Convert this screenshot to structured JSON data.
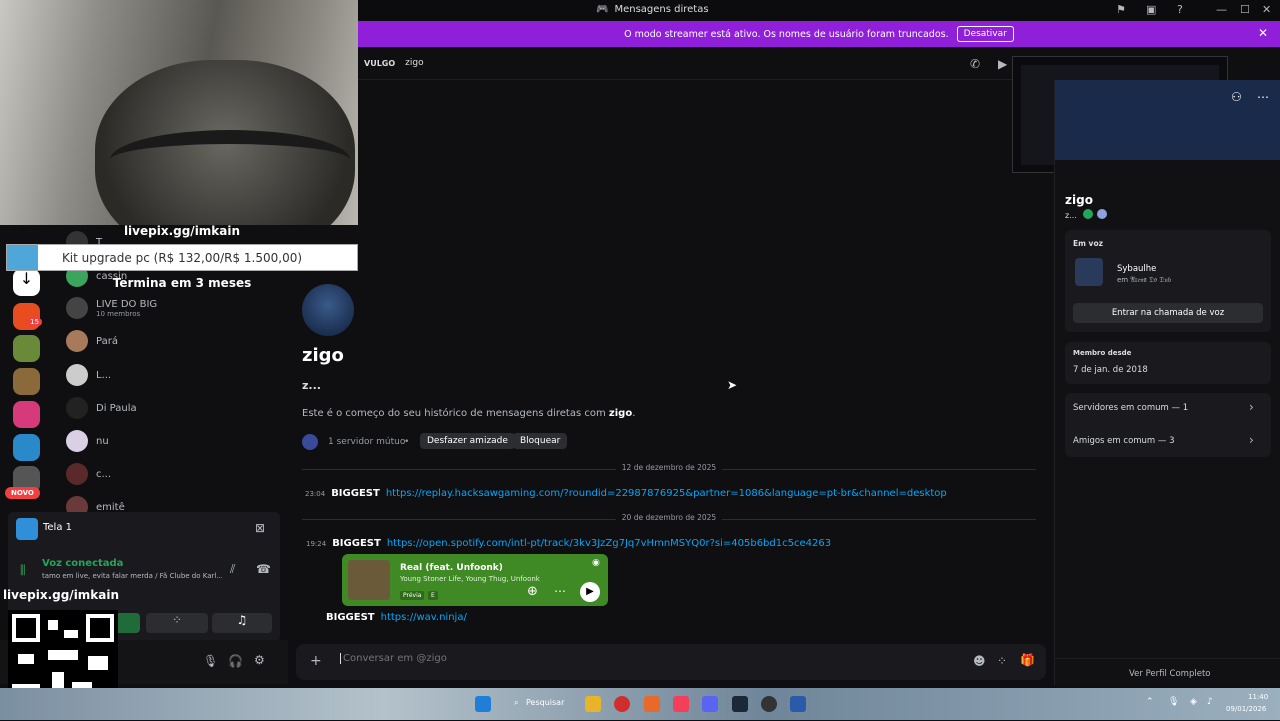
{
  "window": {
    "title": "Mensagens diretas"
  },
  "streamer_banner": {
    "text": "O modo streamer está ativo. Os nomes de usuário foram truncados.",
    "button": "Desativar"
  },
  "topbar": {
    "tag": "VULGO",
    "name": "zigo"
  },
  "overlay": {
    "livepix_top": "livepix.gg/imkain",
    "goal_label": "Kit upgrade pc (R$ 132,00/R$ 1.500,00)",
    "goal_progress": 0.088,
    "ends": "Termina em 3 meses",
    "livepix_bottom": "livepix.gg/imkain"
  },
  "servers": {
    "badge_15": "15",
    "new_badge": "NOVO"
  },
  "dm_list": [
    {
      "name": "T",
      "sub": ""
    },
    {
      "name": "cassin",
      "sub": ""
    },
    {
      "name": "LIVE DO BIG",
      "sub": "10 membros"
    },
    {
      "name": "Pará",
      "sub": ""
    },
    {
      "name": "L...",
      "sub": ""
    },
    {
      "name": "Di Paula",
      "sub": ""
    },
    {
      "name": "nu",
      "sub": ""
    },
    {
      "name": "c...",
      "sub": ""
    },
    {
      "name": "emitê",
      "sub": ""
    }
  ],
  "screen_share": {
    "title": "Tela 1"
  },
  "voice": {
    "status": "Voz conectada",
    "channel": "tamo em live, evita falar merda / Fã Clube do Karl..."
  },
  "profile_intro": {
    "name": "zigo",
    "status": "z...",
    "intro_prefix": "Este é o começo do seu histórico de mensagens diretas com ",
    "intro_name": "zigo",
    "mutual_servers": "1 servidor mútuo",
    "unfriend": "Desfazer amizade",
    "block": "Bloquear"
  },
  "messages": [
    {
      "date": "12 de dezembro de 2025"
    },
    {
      "time": "23:04",
      "author": "BIGGEST",
      "link": "https://replay.hacksawgaming.com/?roundid=22987876925&partner=1086&language=pt-br&channel=desktop"
    },
    {
      "date": "20 de dezembro de 2025"
    },
    {
      "time": "19:24",
      "author": "BIGGEST",
      "link": "https://open.spotify.com/intl-pt/track/3kv3JzZg7Jq7vHmnMSYQ0r?si=405b6bd1c5ce4263"
    },
    {
      "author": "BIGGEST",
      "link": "https://wav.ninja/"
    }
  ],
  "spotify_card": {
    "track": "Real (feat. Unfoonk)",
    "artists": "Young Stoner Life, Young Thug, Unfoonk",
    "preview": "Prévia",
    "explicit": "E"
  },
  "input": {
    "placeholder": "Conversar em @zigo"
  },
  "right_panel": {
    "name": "zigo",
    "status": "z...",
    "in_voice_label": "Em voz",
    "voice_user": "Sybaulhe",
    "voice_place": "em 𝔄𝔯𝔢𝔫𝔞 𝔇𝔬 𝔇𝔲𝔟",
    "join_voice": "Entrar na chamada de voz",
    "member_since_label": "Membro desde",
    "member_since": "7 de jan. de 2018",
    "mutual_servers": "Servidores em comum — 1",
    "mutual_friends": "Amigos em comum — 3",
    "view_profile": "Ver Perfil Completo"
  },
  "taskbar": {
    "search": "Pesquisar",
    "time": "11:40",
    "date": "09/01/2026"
  }
}
